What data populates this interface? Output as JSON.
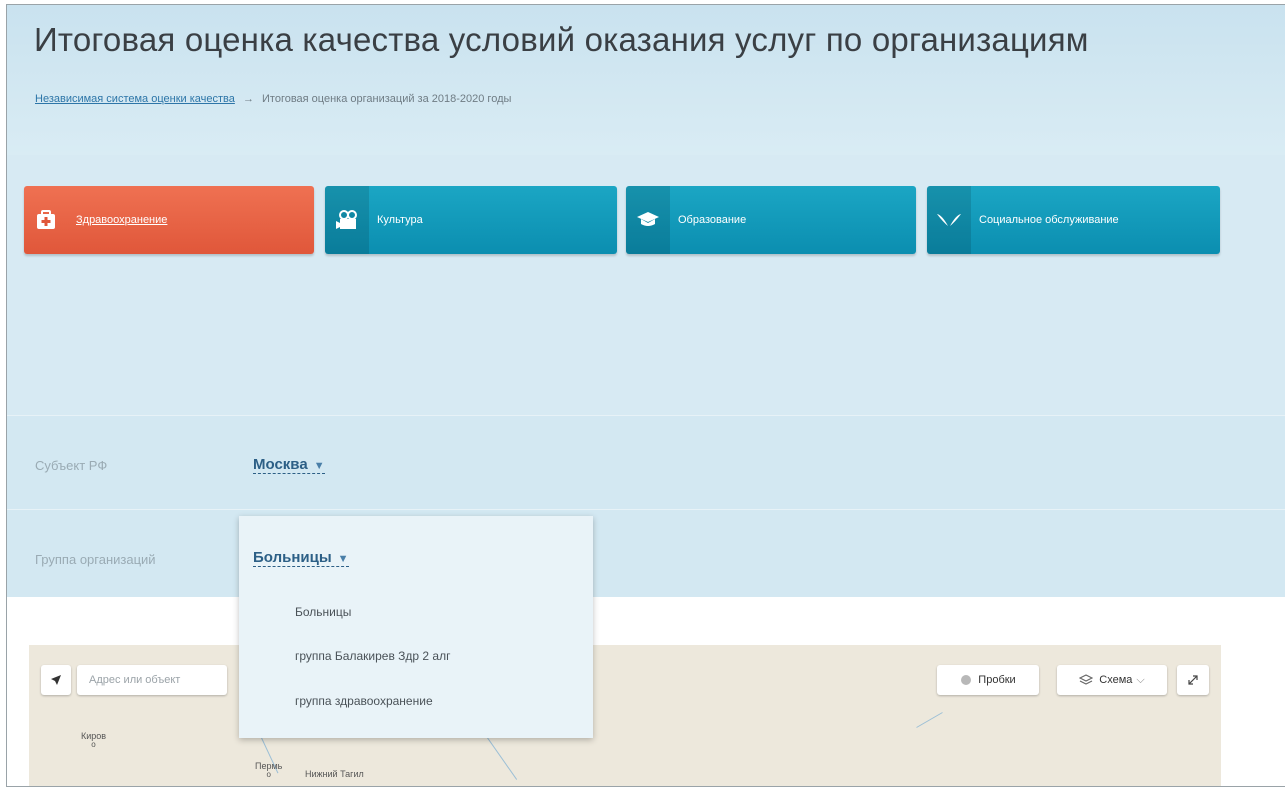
{
  "header": {
    "title": "Итоговая оценка качества условий оказания услуг по организациям",
    "breadcrumb": {
      "link": "Независимая система оценки качества",
      "separator": "→",
      "current": "Итоговая оценка организаций за 2018-2020 годы"
    }
  },
  "categories": [
    {
      "label": "Здравоохранение",
      "icon": "first-aid-kit-icon",
      "color": "#e85f42",
      "active": true
    },
    {
      "label": "Культура",
      "icon": "film-camera-icon",
      "color": "#139ebd",
      "active": false
    },
    {
      "label": "Образование",
      "icon": "graduation-cap-icon",
      "color": "#139ebd",
      "active": false
    },
    {
      "label": "Социальное обслуживание",
      "icon": "hands-icon",
      "color": "#139ebd",
      "active": false
    }
  ],
  "filters": {
    "subject": {
      "label": "Субъект РФ",
      "value": "Москва",
      "arrow": "▼"
    },
    "group": {
      "label": "Группа организаций",
      "value": "Больницы",
      "arrow": "▼",
      "options": [
        "Больницы",
        "группа Балакирев Здр 2 алг",
        "группа здравоохранение"
      ]
    }
  },
  "map": {
    "search_placeholder": "Адрес или объект",
    "traffic_label": "Пробки",
    "layers_label": "Схема",
    "cities": [
      "Киров",
      "Пермь",
      "Нижний Тагил"
    ]
  }
}
